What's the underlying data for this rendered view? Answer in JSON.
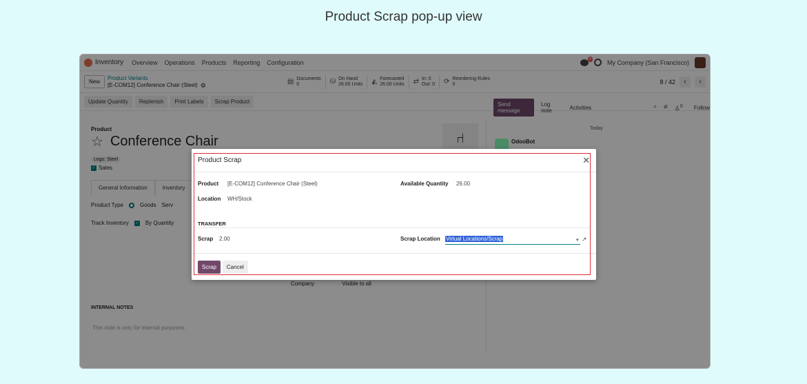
{
  "page_heading": "Product Scrap pop-up view",
  "navbar": {
    "app_name": "Inventory",
    "menu": [
      "Overview",
      "Operations",
      "Products",
      "Reporting",
      "Configuration"
    ],
    "message_count": "8",
    "company": "My Company (San Francisco)"
  },
  "control": {
    "new_label": "New",
    "breadcrumb_parent": "Product Variants",
    "breadcrumb_current": "[E-COM12] Conference Chair (Steel)",
    "stats": [
      {
        "label": "Documents",
        "value": "0"
      },
      {
        "label": "On Hand",
        "value": "26.00 Units"
      },
      {
        "label": "Forecasted",
        "value": "26.00 Units"
      },
      {
        "label": "In: 0",
        "value": "Out: 0"
      },
      {
        "label": "Reordering Rules",
        "value": "0"
      }
    ],
    "pager": "8 / 42"
  },
  "actions": {
    "update_quantity": "Update Quantity",
    "replenish": "Replenish",
    "print_labels": "Print Labels",
    "scrap_product": "Scrap Product"
  },
  "chatter": {
    "send_message": "Send message",
    "log_note": "Log note",
    "activities": "Activities",
    "follower_count": "0",
    "follow": "Follow",
    "today": "Today",
    "author": "OdooBot"
  },
  "form": {
    "product_label": "Product",
    "product_name": "Conference Chair",
    "tag": "Legs: Steel",
    "sales": "Sales",
    "tabs": [
      "General Information",
      "Inventory"
    ],
    "product_type_label": "Product Type",
    "product_type_value": "Goods",
    "product_type_next": "Serv",
    "track_inventory_label": "Track Inventory",
    "track_inventory_value": "By Quantity",
    "company_label": "Company",
    "company_value": "Visible to all",
    "internal_notes": "INTERNAL NOTES",
    "notes_placeholder": "This note is only for internal purposes."
  },
  "modal": {
    "title": "Product Scrap",
    "product_label": "Product",
    "product_value": "[E-COM12] Conference Chair (Steel)",
    "location_label": "Location",
    "location_value": "WH/Stock",
    "available_qty_label": "Available Quantity",
    "available_qty_value": "26.00",
    "transfer_heading": "TRANSFER",
    "scrap_label": "Scrap",
    "scrap_value": "2.00",
    "scrap_location_label": "Scrap Location",
    "scrap_location_value": "Virtual Locations/Scrap",
    "scrap_button": "Scrap",
    "cancel_button": "Cancel"
  }
}
